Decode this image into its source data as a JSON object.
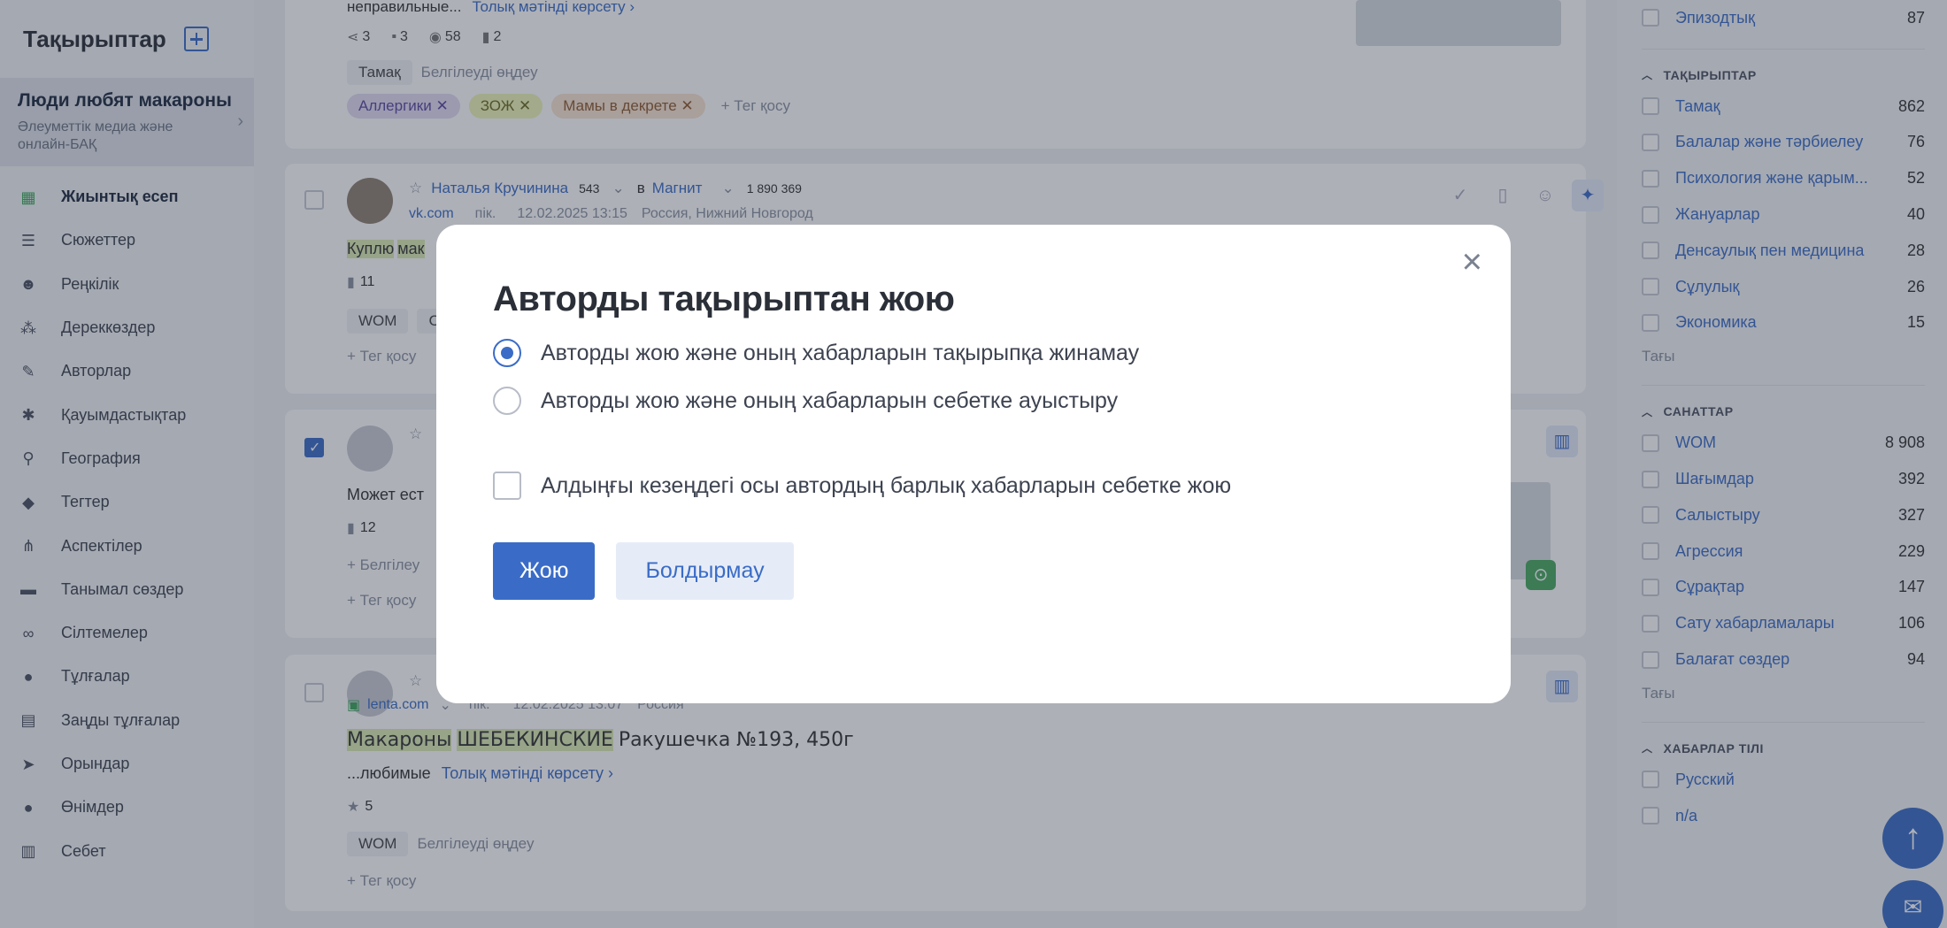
{
  "sidebar": {
    "title": "Тақырыптар",
    "topic": {
      "name": "Люди любят макароны",
      "subtitle": "Әлеуметтік медиа және онлайн-БАҚ"
    },
    "items": [
      {
        "label": "Жиынтық есеп",
        "icon": "dashboard-icon",
        "glyph": "▦"
      },
      {
        "label": "Сюжеттер",
        "icon": "stories-icon",
        "glyph": "☰"
      },
      {
        "label": "Реңкілік",
        "icon": "smile-icon",
        "glyph": "☻"
      },
      {
        "label": "Дереккөздер",
        "icon": "sources-icon",
        "glyph": "⁂"
      },
      {
        "label": "Авторлар",
        "icon": "authors-icon",
        "glyph": "✎"
      },
      {
        "label": "Қауымдастықтар",
        "icon": "communities-icon",
        "glyph": "✱"
      },
      {
        "label": "География",
        "icon": "location-icon",
        "glyph": "⚲"
      },
      {
        "label": "Тегтер",
        "icon": "tag-icon",
        "glyph": "◆"
      },
      {
        "label": "Аспектілер",
        "icon": "aspects-icon",
        "glyph": "⋔"
      },
      {
        "label": "Танымал сөздер",
        "icon": "chat-icon",
        "glyph": "▬"
      },
      {
        "label": "Сілтемелер",
        "icon": "link-icon",
        "glyph": "∞"
      },
      {
        "label": "Тұлғалар",
        "icon": "person-icon",
        "glyph": "●"
      },
      {
        "label": "Заңды тұлғалар",
        "icon": "briefcase-icon",
        "glyph": "▤"
      },
      {
        "label": "Орындар",
        "icon": "navigation-icon",
        "glyph": "➤"
      },
      {
        "label": "Өнімдер",
        "icon": "product-icon",
        "glyph": "●"
      },
      {
        "label": "Себет",
        "icon": "trash-icon",
        "glyph": "▥"
      }
    ]
  },
  "feed": {
    "card1": {
      "text": "неправильные...",
      "more": "Толық мәтінді көрсету ›",
      "stats": [
        "3",
        "3",
        "58",
        "2"
      ],
      "tag": "Тамақ",
      "edit": "Белгілеуді өңдеу",
      "chips": [
        "Аллергики",
        "ЗОЖ",
        "Мамы в декрете"
      ],
      "add_tag": "+ Тег қосу"
    },
    "card2": {
      "author": "Наталья Кручинина",
      "author_followers": "543",
      "in": "в",
      "group": "Магнит",
      "group_followers": "1 890 369",
      "source": "vk.com",
      "type": "пік.",
      "date": "12.02.2025 13:15",
      "location": "Россия, Нижний Новгород",
      "text_hl": "Куплю",
      "text_hl2": "мак",
      "stat": "11",
      "tag": "WOM",
      "tag2": "С",
      "add_tag": "+ Тег қосу"
    },
    "card3": {
      "text": "Может ест",
      "stat": "12",
      "edit": "+ Белгілеу",
      "add_tag": "+ Тег қосу"
    },
    "card4": {
      "source": "lenta.com",
      "type": "пік.",
      "date": "12.02.2025 13:07",
      "location": "Россия",
      "title_hl1": "Макароны",
      "title_hl2": "ШЕБЕКИНСКИЕ",
      "title_rest": "Ракушечка №193, 450г",
      "text": "...любимые",
      "more": "Толық мәтінді көрсету ›",
      "stat": "5",
      "tag": "WOM",
      "edit": "Белгілеуді өңдеу",
      "add_tag": "+ Тег қосу"
    }
  },
  "rightpanel": {
    "top_item": {
      "label": "Эпизодтық",
      "count": "87"
    },
    "sections": [
      {
        "title": "ТАҚЫРЫПТАР",
        "items": [
          {
            "label": "Тамақ",
            "count": "862"
          },
          {
            "label": "Балалар және тәрбиелеу",
            "count": "76"
          },
          {
            "label": "Психология және қарым...",
            "count": "52"
          },
          {
            "label": "Жануарлар",
            "count": "40"
          },
          {
            "label": "Денсаулық пен медицина",
            "count": "28"
          },
          {
            "label": "Сұлулық",
            "count": "26"
          },
          {
            "label": "Экономика",
            "count": "15"
          }
        ],
        "more": "Тағы"
      },
      {
        "title": "САНАТТАР",
        "items": [
          {
            "label": "WOM",
            "count": "8 908"
          },
          {
            "label": "Шағымдар",
            "count": "392"
          },
          {
            "label": "Салыстыру",
            "count": "327"
          },
          {
            "label": "Агрессия",
            "count": "229"
          },
          {
            "label": "Сұрақтар",
            "count": "147"
          },
          {
            "label": "Сату хабарламалары",
            "count": "106"
          },
          {
            "label": "Балағат сөздер",
            "count": "94"
          }
        ],
        "more": "Тағы"
      },
      {
        "title": "ХАБАРЛАР ТІЛІ",
        "items": [
          {
            "label": "Русский",
            "count": ""
          },
          {
            "label": "n/a",
            "count": "2"
          }
        ]
      }
    ]
  },
  "modal": {
    "title": "Авторды тақырыптан жою",
    "option1": "Авторды жою және оның хабарларын тақырыпқа жинамау",
    "option2": "Авторды жою және оның хабарларын себетке ауыстыру",
    "checkbox": "Алдыңғы кезеңдегі осы автордың барлық хабарларын себетке жою",
    "confirm": "Жою",
    "cancel": "Болдырмау",
    "close": "×"
  },
  "colors": {
    "accent": "#3a6cc7",
    "active_green": "#39a85b",
    "highlight": "#dcecb4"
  }
}
